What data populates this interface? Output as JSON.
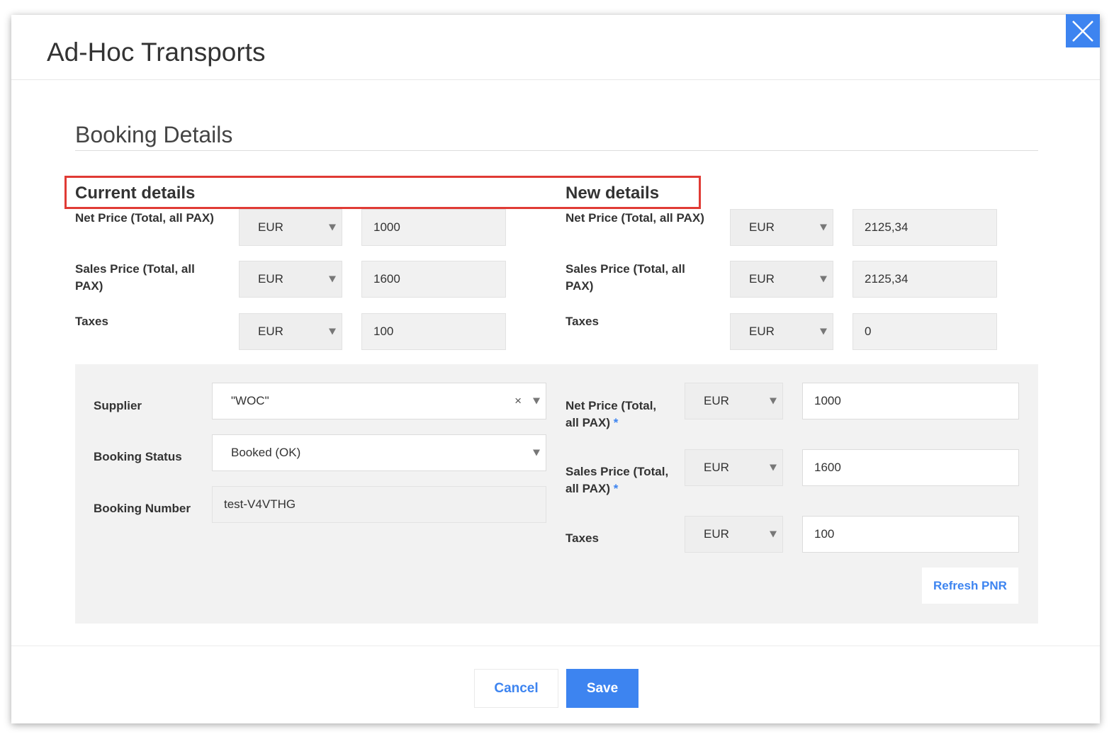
{
  "modal": {
    "title": "Ad-Hoc Transports",
    "close_icon": "close-icon"
  },
  "section": {
    "title": "Booking Details"
  },
  "current": {
    "heading": "Current details",
    "net_price": {
      "label": "Net Price (Total, all PAX)",
      "currency": "EUR",
      "value": "1000"
    },
    "sales_price": {
      "label": "Sales Price (Total, all PAX)",
      "currency": "EUR",
      "value": "1600"
    },
    "taxes": {
      "label": "Taxes",
      "currency": "EUR",
      "value": "100"
    }
  },
  "new": {
    "heading": "New details",
    "net_price": {
      "label": "Net Price (Total, all PAX)",
      "currency": "EUR",
      "value": "2125,34"
    },
    "sales_price": {
      "label": "Sales Price (Total, all PAX)",
      "currency": "EUR",
      "value": "2125,34"
    },
    "taxes": {
      "label": "Taxes",
      "currency": "EUR",
      "value": "0"
    }
  },
  "form": {
    "supplier": {
      "label": "Supplier",
      "value": "\"WOC\"",
      "clear": "×"
    },
    "booking_status": {
      "label": "Booking Status",
      "value": "Booked (OK)"
    },
    "booking_number": {
      "label": "Booking Number",
      "value": "test-V4VTHG"
    },
    "net_price": {
      "label": "Net Price (Total, all PAX)",
      "required": "*",
      "currency": "EUR",
      "value": "1000"
    },
    "sales_price": {
      "label": "Sales Price (Total, all PAX)",
      "required": "*",
      "currency": "EUR",
      "value": "1600"
    },
    "taxes": {
      "label": "Taxes",
      "currency": "EUR",
      "value": "100"
    },
    "refresh_label": "Refresh PNR"
  },
  "footer": {
    "cancel_label": "Cancel",
    "save_label": "Save"
  },
  "colors": {
    "accent": "#3d84f0",
    "highlight_border": "#e03b35"
  }
}
